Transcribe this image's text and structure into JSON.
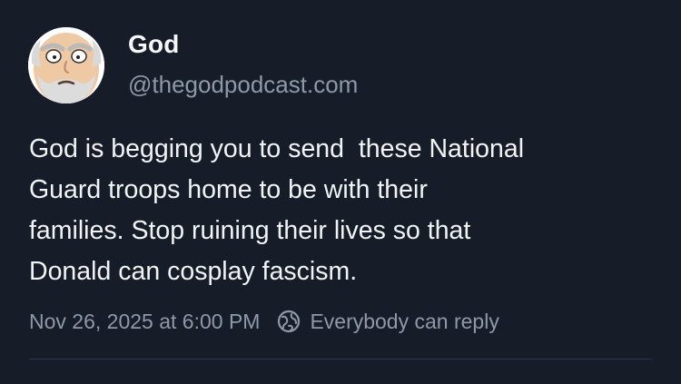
{
  "author": {
    "display_name": "God",
    "handle": "@thegodpodcast.com",
    "avatar_icon": "cartoon-face-avatar"
  },
  "post": {
    "text": "God is begging you to send  these National\nGuard troops home to be with their\nfamilies. Stop ruining their lives so that\nDonald can cosplay fascism.",
    "timestamp": "Nov 26, 2025 at 6:00 PM",
    "reply_setting": "Everybody can reply",
    "reply_icon": "globe-icon"
  },
  "colors": {
    "background": "#171d28",
    "text_primary": "#f1f3f5",
    "text_secondary": "#8e99a8",
    "divider": "#2c3443"
  }
}
